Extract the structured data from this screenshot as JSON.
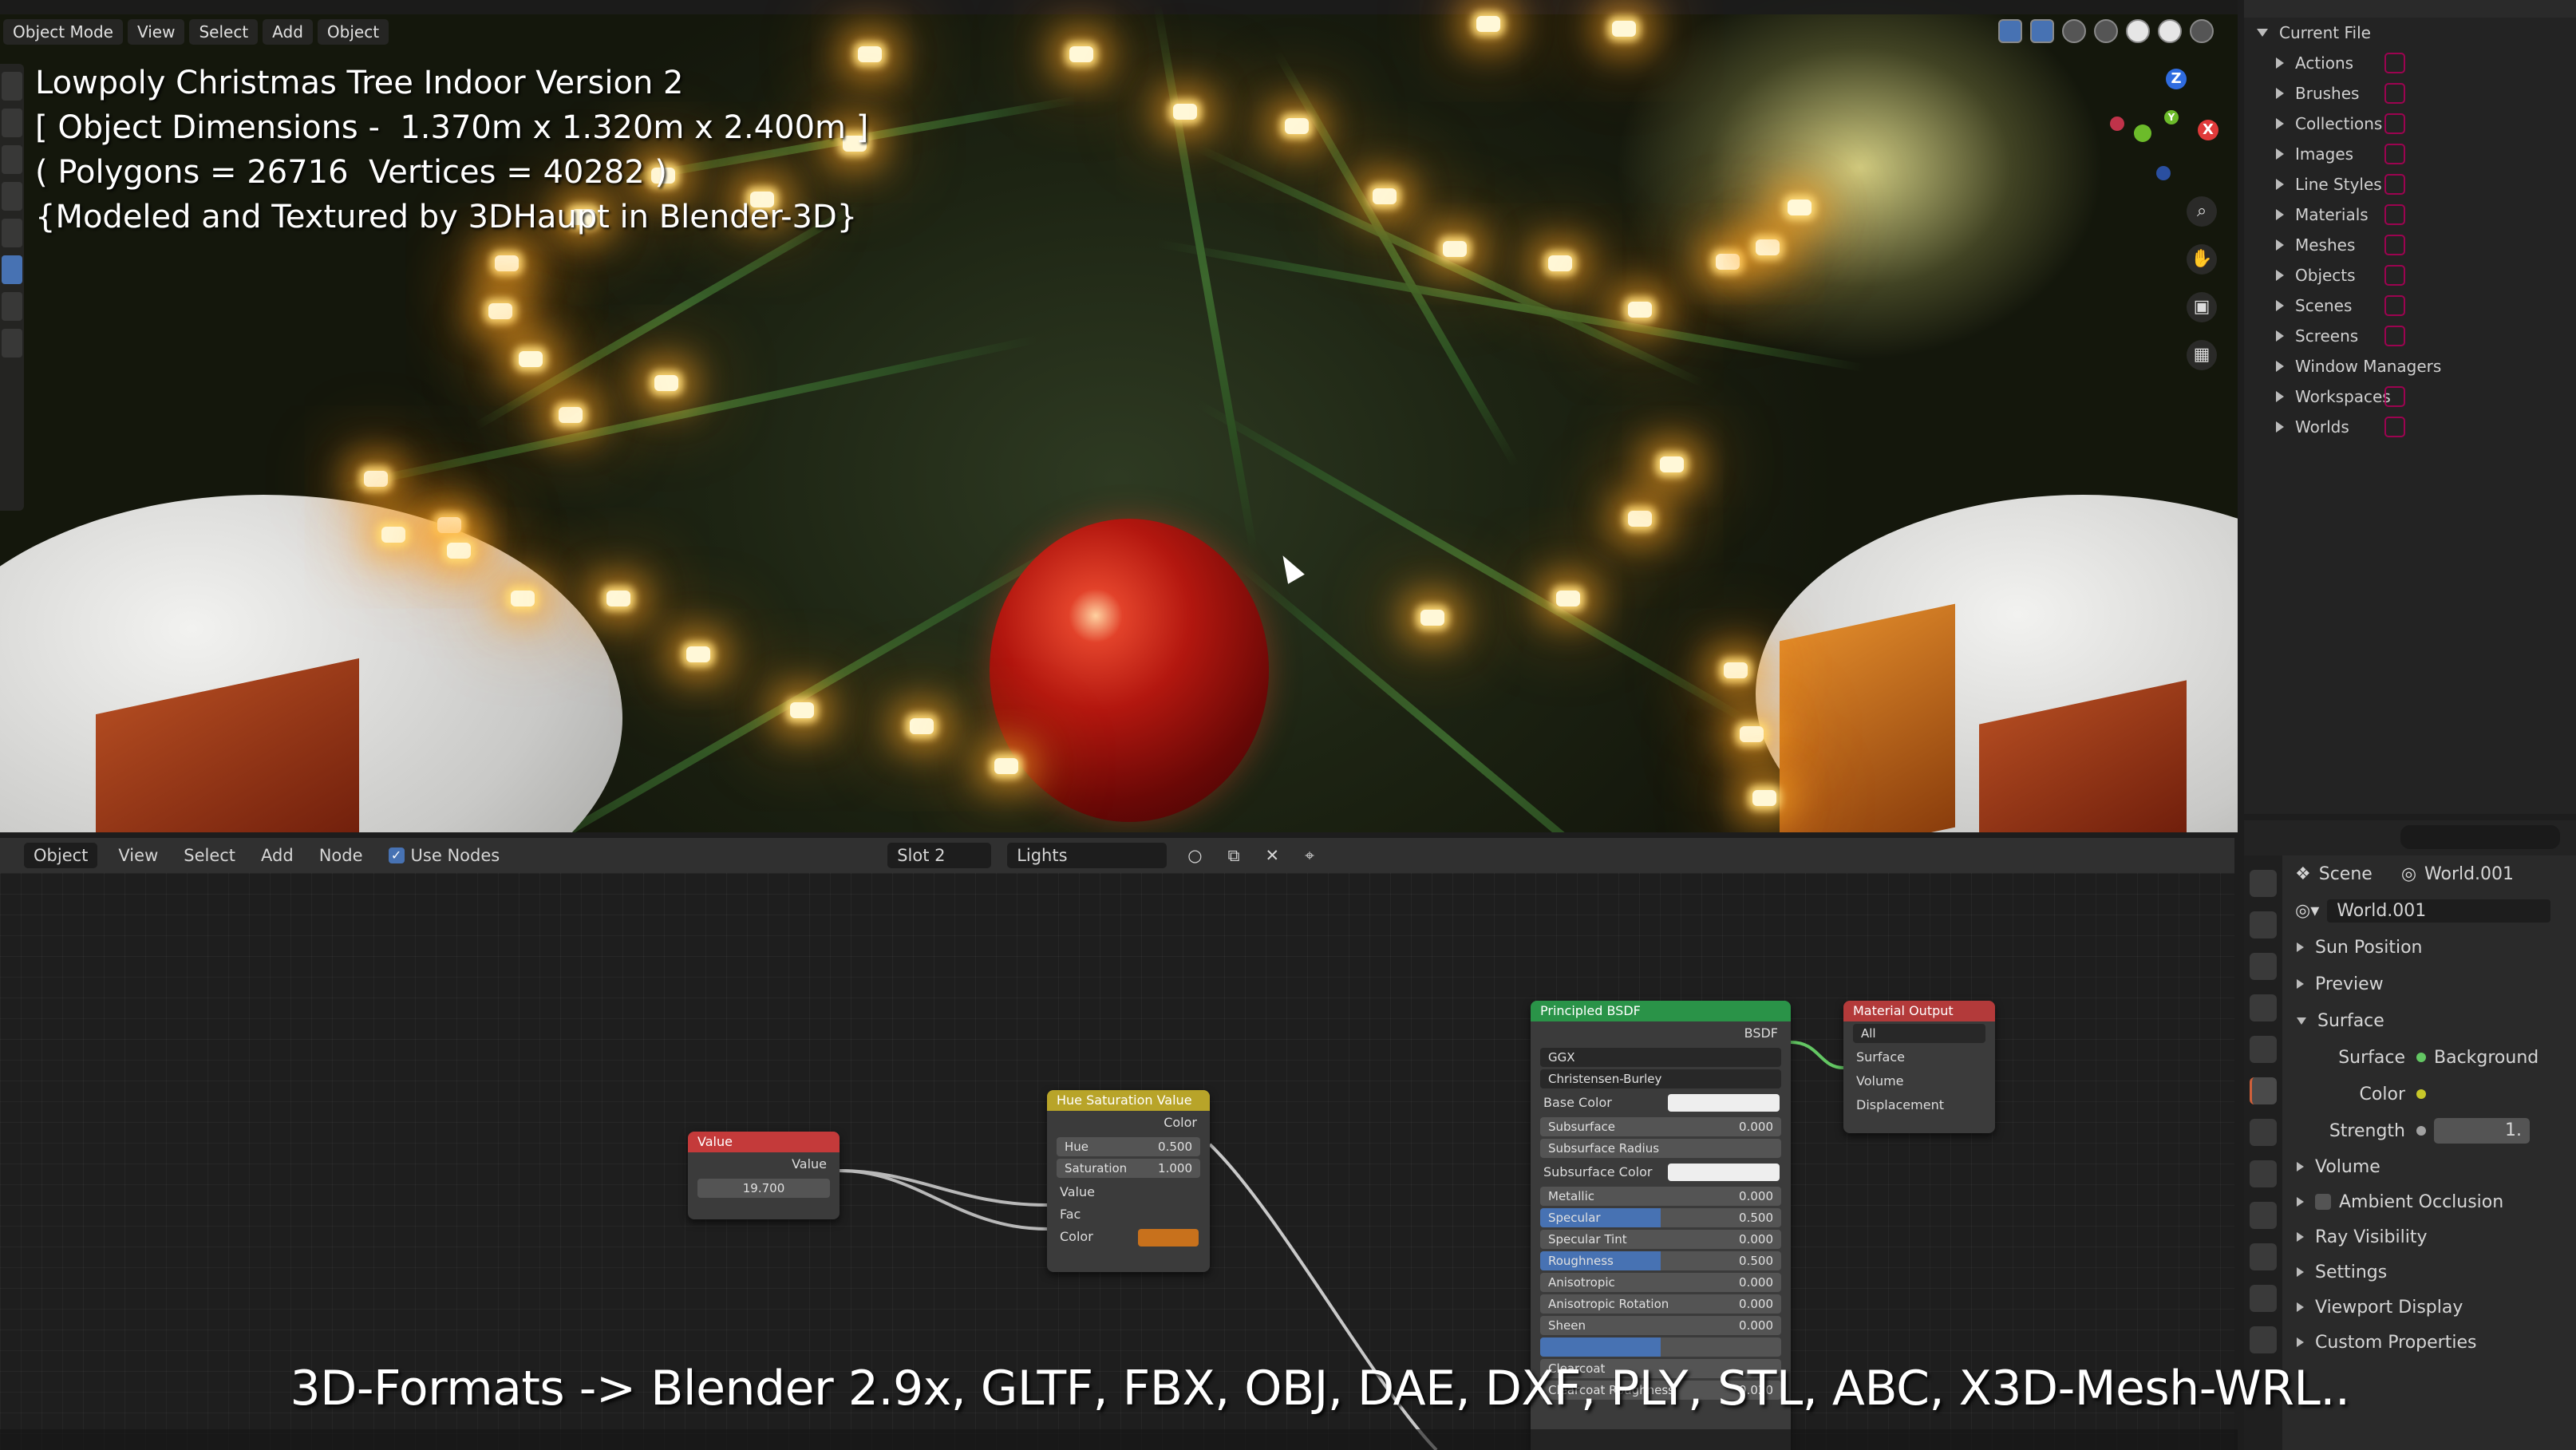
{
  "viewport": {
    "mode": "Object Mode",
    "menu": [
      "View",
      "Select",
      "Add",
      "Object"
    ],
    "info_lines": [
      "Lowpoly Christmas Tree Indoor Version 2",
      "[ Object Dimensions -  1.370m x 1.320m x 2.400m ]",
      "( Polygons = 26716  Vertices = 40282 )",
      "{Modeled and Textured by 3DHaupt in Blender-3D}"
    ],
    "gizmo": {
      "x": "X",
      "y": "Y",
      "z": "Z"
    }
  },
  "outliner": {
    "root": "Current File",
    "items": [
      {
        "label": "Actions",
        "icon": "action-icon"
      },
      {
        "label": "Brushes",
        "icon": "brush-icon"
      },
      {
        "label": "Collections",
        "icon": "collection-icon"
      },
      {
        "label": "Images",
        "icon": "image-icon"
      },
      {
        "label": "Line Styles",
        "icon": "linestyle-icon"
      },
      {
        "label": "Materials",
        "icon": "material-icon"
      },
      {
        "label": "Meshes",
        "icon": "mesh-icon"
      },
      {
        "label": "Objects",
        "icon": "object-icon"
      },
      {
        "label": "Scenes",
        "icon": "scene-icon"
      },
      {
        "label": "Screens",
        "icon": "screen-icon"
      },
      {
        "label": "Window Managers",
        "icon": ""
      },
      {
        "label": "Workspaces",
        "icon": "workspace-icon"
      },
      {
        "label": "Worlds",
        "icon": "world-icon"
      }
    ]
  },
  "node_editor": {
    "editor_type": "Object",
    "menu": [
      "View",
      "Select",
      "Add",
      "Node"
    ],
    "use_nodes": "Use Nodes",
    "slot": "Slot 2",
    "material": "Lights",
    "nodes": {
      "value": {
        "title": "Value",
        "output": "Value",
        "value": "19.700"
      },
      "hsv": {
        "title": "Hue Saturation Value",
        "output": "Color",
        "hue_label": "Hue",
        "hue": "0.500",
        "sat_label": "Saturation",
        "sat": "1.000",
        "in_value": "Value",
        "in_fac": "Fac",
        "in_color": "Color"
      },
      "bsdf": {
        "title": "Principled BSDF",
        "output": "BSDF",
        "distribution": "GGX",
        "subsurface_method": "Christensen-Burley",
        "rows": [
          {
            "label": "Base Color",
            "value": "",
            "kind": "swatch"
          },
          {
            "label": "Subsurface",
            "value": "0.000",
            "kind": "field"
          },
          {
            "label": "Subsurface Radius",
            "value": "",
            "kind": "dropdown"
          },
          {
            "label": "Subsurface Color",
            "value": "",
            "kind": "swatch"
          },
          {
            "label": "Metallic",
            "value": "0.000",
            "kind": "field"
          },
          {
            "label": "Specular",
            "value": "0.500",
            "kind": "blue"
          },
          {
            "label": "Specular Tint",
            "value": "0.000",
            "kind": "field"
          },
          {
            "label": "Roughness",
            "value": "0.500",
            "kind": "blue"
          },
          {
            "label": "Anisotropic",
            "value": "0.000",
            "kind": "field"
          },
          {
            "label": "Anisotropic Rotation",
            "value": "0.000",
            "kind": "field"
          },
          {
            "label": "Sheen",
            "value": "0.000",
            "kind": "field"
          },
          {
            "label": "",
            "value": "",
            "kind": "blue"
          },
          {
            "label": "Clearcoat",
            "value": "",
            "kind": "field"
          },
          {
            "label": "Clearcoat Roughness",
            "value": "0.030",
            "kind": "field"
          }
        ]
      },
      "output": {
        "title": "Material Output",
        "target": "All",
        "surface": "Surface",
        "volume": "Volume",
        "displacement": "Displacement"
      }
    }
  },
  "properties": {
    "scene": "Scene",
    "world": "World.001",
    "world_field": "World.001",
    "panels": [
      "Sun Position",
      "Preview",
      "Surface"
    ],
    "surface_label": "Surface",
    "surface_value": "Background",
    "color_label": "Color",
    "strength_label": "Strength",
    "strength_value": "1.",
    "panels_after": [
      "Volume",
      "Ambient Occlusion",
      "Ray Visibility",
      "Settings",
      "Viewport Display",
      "Custom Properties"
    ]
  },
  "subtitle": "3D-Formats -> Blender 2.9x, GLTF, FBX, OBJ, DAE, DXF, PLY, STL, ABC, X3D-Mesh-WRL..",
  "colors": {
    "accent_blue": "#4772b3",
    "value_node": "#cc3b3b",
    "hsv_node": "#c7b12a",
    "bsdf_node": "#2a9a4a",
    "output_node": "#b33a3a"
  }
}
